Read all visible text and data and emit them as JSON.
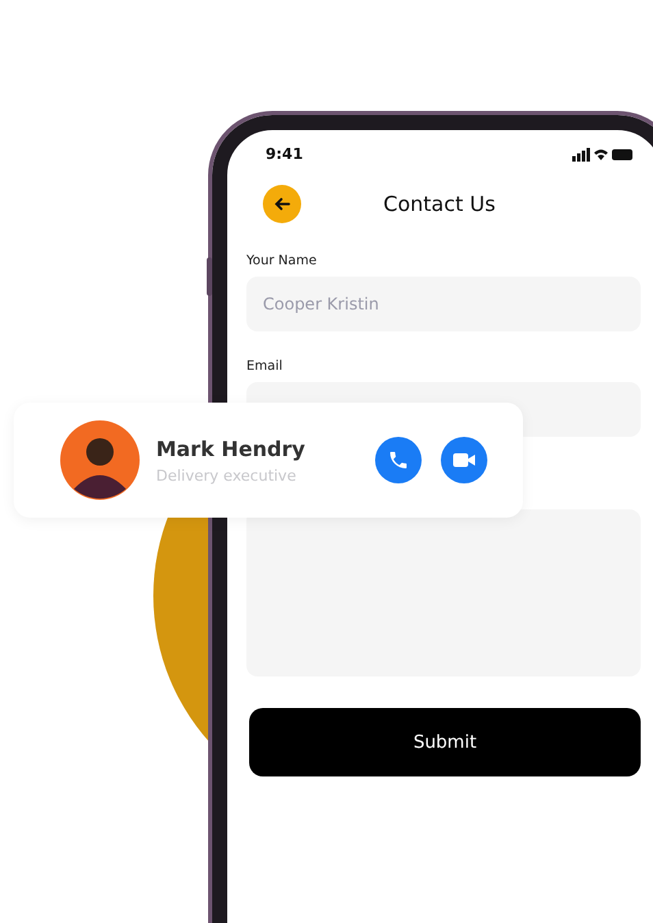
{
  "status_bar": {
    "time": "9:41"
  },
  "header": {
    "title": "Contact Us"
  },
  "form": {
    "fields": [
      {
        "kind": "input",
        "label": "Your Name",
        "placeholder": "Cooper Kristin"
      },
      {
        "kind": "input",
        "label": "Email"
      },
      {
        "kind": "textarea"
      }
    ],
    "submit": "Submit"
  },
  "contact_card": {
    "name": "Mark Hendry",
    "role": "Delivery executive"
  }
}
